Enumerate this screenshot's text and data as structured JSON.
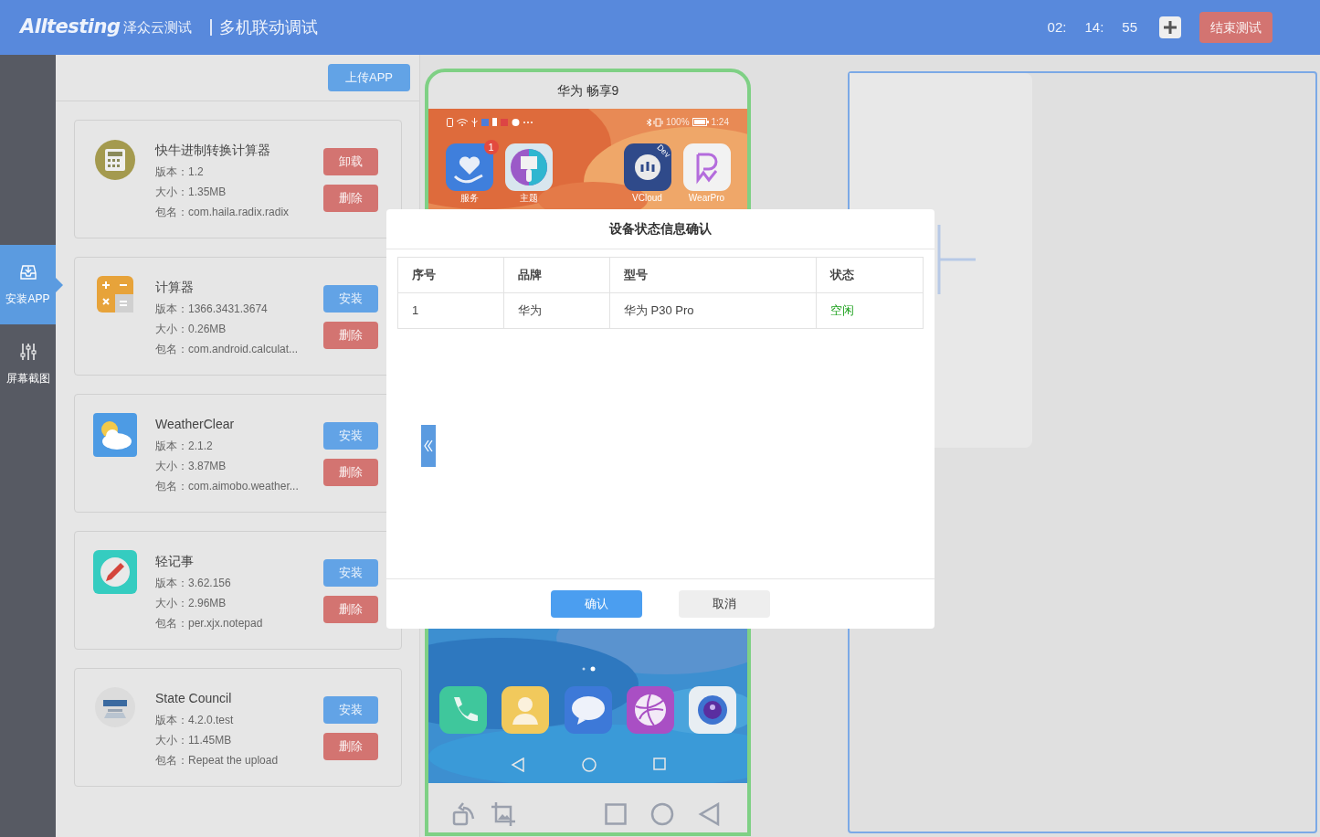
{
  "header": {
    "logo": "Alltesting",
    "logo_suffix": "泽众云测试",
    "title": "多机联动调试",
    "timer": [
      "02:",
      "14:",
      "55"
    ],
    "end_button": "结束测试"
  },
  "sidebar": {
    "items": [
      {
        "label": "安装APP",
        "kind": "install",
        "selected": true
      },
      {
        "label": "屏幕截图",
        "kind": "screenshot",
        "selected": false
      }
    ]
  },
  "apps_panel": {
    "upload_button": "上传APP",
    "apps": [
      {
        "name": "快牛进制转换计算器",
        "version": "版本：1.2",
        "size": "大小：1.35MB",
        "package": "包名：com.haila.radix.radix",
        "action": {
          "label": "卸载",
          "kind": "uninstall"
        },
        "delete": "删除"
      },
      {
        "name": "计算器",
        "version": "版本：1366.3431.3674",
        "size": "大小：0.26MB",
        "package": "包名：com.android.calculat...",
        "action": {
          "label": "安装",
          "kind": "install"
        },
        "delete": "删除"
      },
      {
        "name": "WeatherClear",
        "version": "版本：2.1.2",
        "size": "大小：3.87MB",
        "package": "包名：com.aimobo.weather...",
        "action": {
          "label": "安装",
          "kind": "install"
        },
        "delete": "删除"
      },
      {
        "name": "轻记事",
        "version": "版本：3.62.156",
        "size": "大小：2.96MB",
        "package": "包名：per.xjx.notepad",
        "action": {
          "label": "安装",
          "kind": "install"
        },
        "delete": "删除"
      },
      {
        "name": "State Council",
        "version": "版本：4.2.0.test",
        "size": "大小：11.45MB",
        "package": "包名：Repeat the upload",
        "action": {
          "label": "安装",
          "kind": "install"
        },
        "delete": "删除"
      }
    ]
  },
  "phone": {
    "title": "华为 畅享9",
    "status_battery": "100%",
    "status_time": "1:24",
    "apps": [
      {
        "label": "服务",
        "badge": "1"
      },
      {
        "label": "主题"
      },
      {
        "label": "VCloud",
        "ribbon": "Dev"
      },
      {
        "label": "WearPro"
      }
    ]
  },
  "dialog": {
    "title": "设备状态信息确认",
    "columns": [
      "序号",
      "品牌",
      "型号",
      "状态"
    ],
    "rows": [
      {
        "cells": [
          "1",
          "华为",
          "华为 P30 Pro",
          "空闲"
        ]
      }
    ],
    "confirm": "确认",
    "cancel": "取消"
  }
}
